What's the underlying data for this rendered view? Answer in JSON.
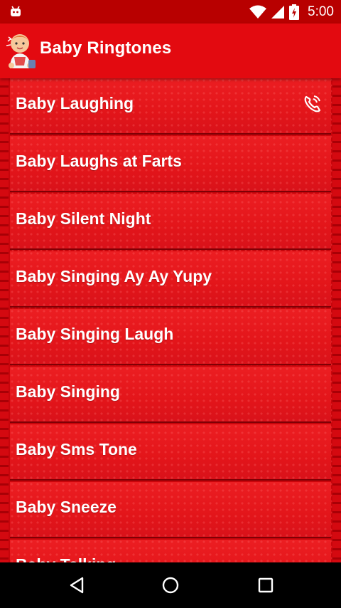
{
  "status_bar": {
    "time": "5:00",
    "icons": [
      "android-icon",
      "wifi-icon",
      "signal-icon",
      "battery-charging-icon"
    ]
  },
  "app_bar": {
    "title": "Baby Ringtones",
    "logo": "baby-logo-icon"
  },
  "ringtones": [
    {
      "label": "Baby Laughing",
      "icon": "ringtone-phone-icon"
    },
    {
      "label": "Baby Laughs at Farts"
    },
    {
      "label": "Baby Silent Night"
    },
    {
      "label": "Baby Singing Ay Ay Yupy"
    },
    {
      "label": "Baby Singing Laugh"
    },
    {
      "label": "Baby Singing"
    },
    {
      "label": "Baby Sms Tone"
    },
    {
      "label": "Baby Sneeze"
    },
    {
      "label": "Baby Talking"
    }
  ],
  "nav_bar": {
    "buttons": [
      "back-icon",
      "home-icon",
      "recents-icon"
    ]
  },
  "colors": {
    "status_bar": "#b80000",
    "app_bar": "#e30a10",
    "list_item": "#e3151a",
    "nav_bar": "#000000",
    "text": "#ffffff"
  }
}
